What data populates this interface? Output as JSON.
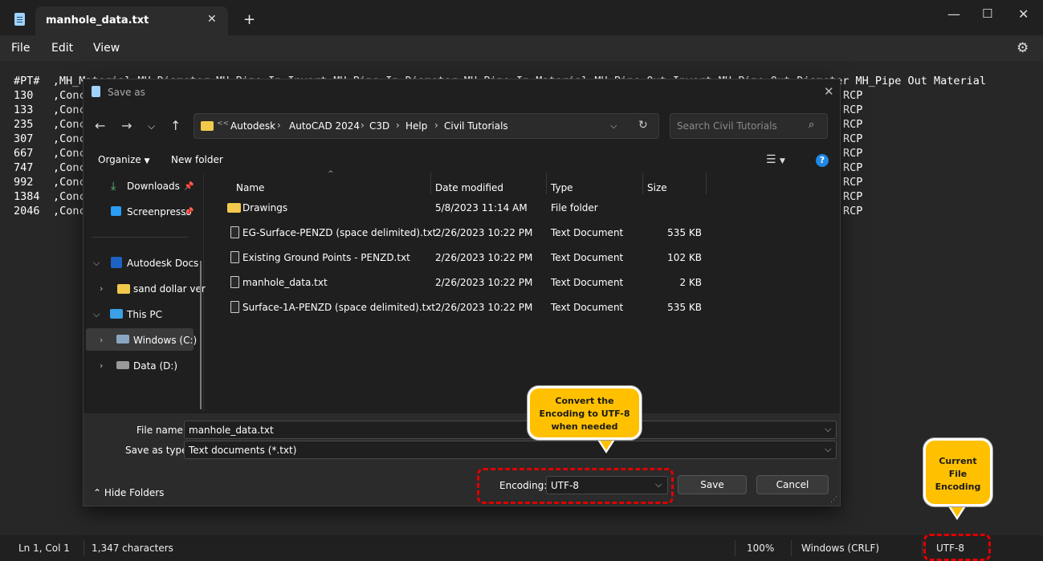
{
  "app": {
    "tab_title": "manhole_data.txt",
    "new_tab": "+",
    "menu": [
      "File",
      "Edit",
      "View"
    ]
  },
  "editor": {
    "header": "#PT#  ,MH_Material MH_Diameter MH_Pipe In Invert MH_Pipe In Diameter MH_Pipe In Material MH_Pipe Out Invert MH_Pipe Out Diameter MH_Pipe Out Material",
    "rows": [
      {
        "pt": "130",
        "start": ",Conc",
        "end": "RCP"
      },
      {
        "pt": "133",
        "start": ",Conc",
        "end": "RCP"
      },
      {
        "pt": "235",
        "start": ",Conc",
        "end": "RCP"
      },
      {
        "pt": "307",
        "start": ",Conc",
        "end": "RCP"
      },
      {
        "pt": "667",
        "start": ",Conc",
        "end": "RCP"
      },
      {
        "pt": "747",
        "start": ",Conc",
        "end": "RCP"
      },
      {
        "pt": "992",
        "start": ",Conc",
        "end": "RCP"
      },
      {
        "pt": "1384",
        "start": ",Conc",
        "end": "RCP"
      },
      {
        "pt": "2046",
        "start": ",Conc",
        "end": "RCP"
      }
    ]
  },
  "status": {
    "position": "Ln 1, Col 1",
    "characters": "1,347 characters",
    "zoom": "100%",
    "line_ending": "Windows (CRLF)",
    "encoding": "UTF-8"
  },
  "dialog": {
    "title": "Save as",
    "breadcrumb_overflow": "<<",
    "breadcrumb": [
      "Autodesk",
      "AutoCAD 2024",
      "C3D",
      "Help",
      "Civil Tutorials"
    ],
    "search_placeholder": "Search Civil Tutorials",
    "organize": "Organize",
    "new_folder": "New folder",
    "help": "?",
    "nav": {
      "downloads": "Downloads",
      "screenpresso": "Screenpresso",
      "autodesk_docs": "Autodesk Docs",
      "sand_dollar": "sand dollar ver",
      "this_pc": "This PC",
      "windows_c": "Windows (C:)",
      "data_d": "Data (D:)"
    },
    "columns": {
      "name": "Name",
      "date": "Date modified",
      "type": "Type",
      "size": "Size"
    },
    "files": [
      {
        "name": "Drawings",
        "date": "5/8/2023 11:14 AM",
        "type": "File folder",
        "size": "",
        "kind": "folder"
      },
      {
        "name": "EG-Surface-PENZD (space delimited).txt",
        "date": "2/26/2023 10:22 PM",
        "type": "Text Document",
        "size": "535 KB",
        "kind": "doc"
      },
      {
        "name": "Existing Ground Points - PENZD.txt",
        "date": "2/26/2023 10:22 PM",
        "type": "Text Document",
        "size": "102 KB",
        "kind": "doc"
      },
      {
        "name": "manhole_data.txt",
        "date": "2/26/2023 10:22 PM",
        "type": "Text Document",
        "size": "2 KB",
        "kind": "doc"
      },
      {
        "name": "Surface-1A-PENZD (space delimited).txt",
        "date": "2/26/2023 10:22 PM",
        "type": "Text Document",
        "size": "535 KB",
        "kind": "doc"
      }
    ],
    "file_name_label": "File name:",
    "file_name_value": "manhole_data.txt",
    "save_type_label": "Save as type:",
    "save_type_value": "Text documents (*.txt)",
    "encoding_label": "Encoding:",
    "encoding_value": "UTF-8",
    "save_label": "Save",
    "cancel_label": "Cancel",
    "hide_folders": "Hide Folders"
  },
  "callouts": {
    "convert_lines": [
      "Convert the",
      "Encoding to UTF-8",
      "when needed"
    ],
    "current_lines": [
      "Current",
      "File",
      "Encoding"
    ]
  },
  "colors": {
    "callout": "#ffc000",
    "highlight": "#e00000",
    "accent": "#1f88e5"
  }
}
